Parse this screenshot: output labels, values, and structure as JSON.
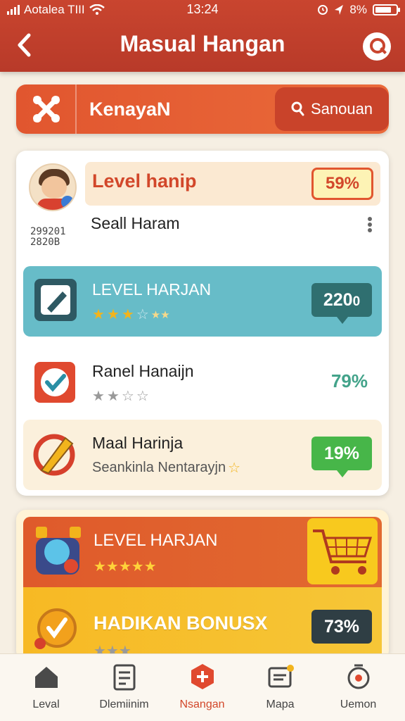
{
  "status_bar": {
    "carrier": "Aotalea TIII",
    "time": "13:24",
    "battery": "8%"
  },
  "header": {
    "title": "Masual Hangan"
  },
  "search_banner": {
    "label": "KenayaN",
    "search_button": "Sanouan"
  },
  "profile_card": {
    "title": "Level hanip",
    "percent": "59%",
    "subtitle": "Seall Haram",
    "code": "299201 2820B"
  },
  "items": [
    {
      "title": "LEVEL HARJAN",
      "value": "220",
      "value_suffix": "0",
      "icon": "edit-icon"
    },
    {
      "title": "Ranel Hanaijn",
      "value": "79%",
      "icon": "checkbox-icon"
    },
    {
      "title": "Maal Harinja",
      "meta": "Seankinla Nentarayjn",
      "value": "19%",
      "icon": "pencil-icon"
    }
  ],
  "promo": {
    "level_title": "LEVEL HARJAN",
    "bonus_title": "HADIKAN BONUSX",
    "bonus_value": "73%"
  },
  "bottom_nav": [
    {
      "label": "Leval",
      "icon": "home-icon"
    },
    {
      "label": "Dlemiinim",
      "icon": "clipboard-icon"
    },
    {
      "label": "Nsangan",
      "icon": "hexagon-add-icon",
      "active": true
    },
    {
      "label": "Mapa",
      "icon": "map-icon"
    },
    {
      "label": "Uemon",
      "icon": "settings-icon"
    }
  ],
  "colors": {
    "header": "#c9452f",
    "accent": "#e1562f",
    "teal": "#67bcc8",
    "green": "#47b649",
    "yellow": "#f7b924"
  }
}
